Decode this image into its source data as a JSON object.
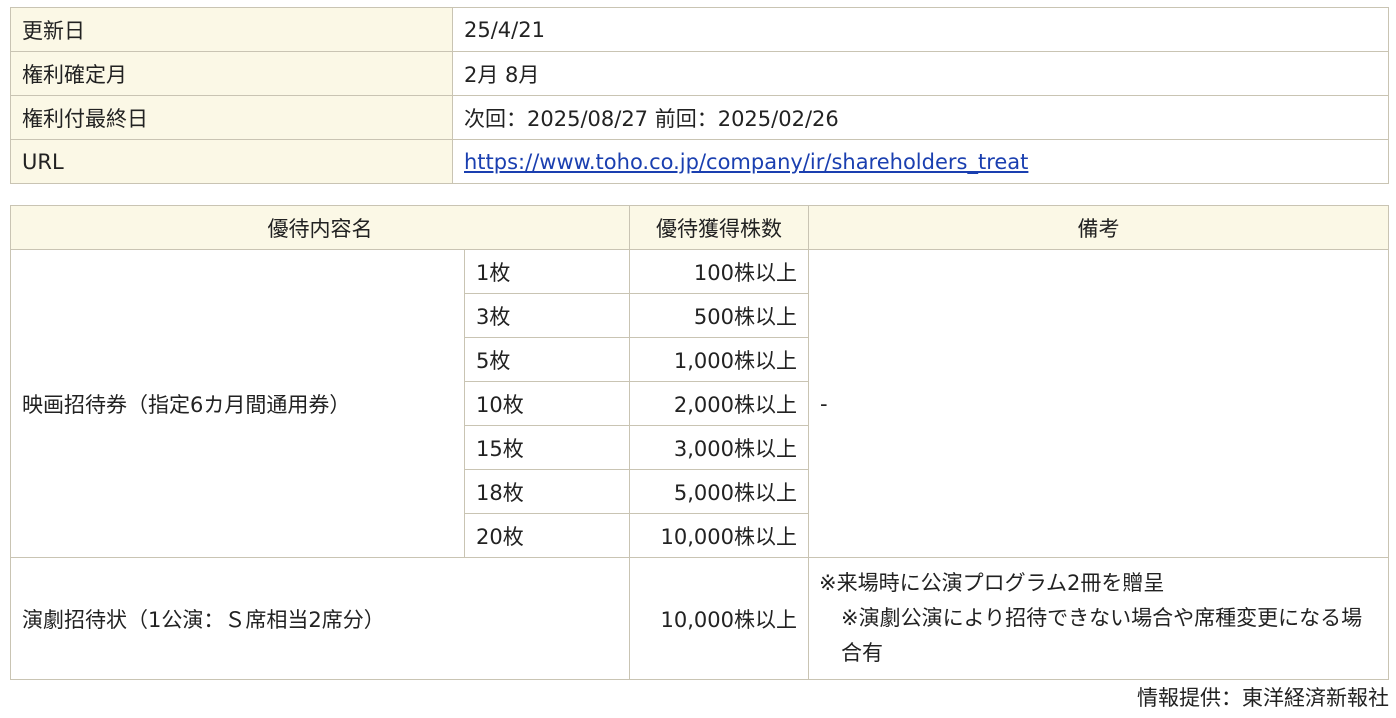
{
  "info": {
    "rows": [
      {
        "label": "更新日",
        "value": "25/4/21"
      },
      {
        "label": "権利確定月",
        "value": "2月 8月"
      },
      {
        "label": "権利付最終日",
        "value": "次回：2025/08/27 前回：2025/02/26"
      },
      {
        "label": "URL",
        "value": "https://www.toho.co.jp/company/ir/shareholders_treat"
      }
    ]
  },
  "perks": {
    "headers": {
      "name": "優待内容名",
      "shares": "優待獲得株数",
      "note": "備考"
    },
    "movie": {
      "name": "映画招待券（指定6カ月間通用券）",
      "note": "-",
      "tiers": [
        {
          "count": "1枚",
          "shares": "100株以上"
        },
        {
          "count": "3枚",
          "shares": "500株以上"
        },
        {
          "count": "5枚",
          "shares": "1,000株以上"
        },
        {
          "count": "10枚",
          "shares": "2,000株以上"
        },
        {
          "count": "15枚",
          "shares": "3,000株以上"
        },
        {
          "count": "18枚",
          "shares": "5,000株以上"
        },
        {
          "count": "20枚",
          "shares": "10,000株以上"
        }
      ]
    },
    "theater": {
      "name": "演劇招待状（1公演：Ｓ席相当2席分）",
      "shares": "10,000株以上",
      "note_line1": "※来場時に公演プログラム2冊を贈呈",
      "note_line2": "※演劇公演により招待できない場合や席種変更になる場合有"
    }
  },
  "credit": "情報提供：東洋経済新報社"
}
